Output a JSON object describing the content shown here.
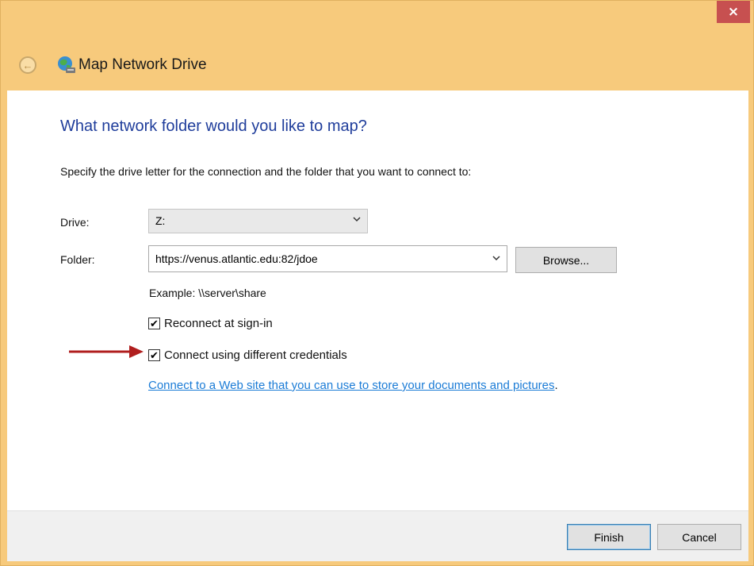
{
  "window": {
    "title": "Map Network Drive",
    "close_label": "×"
  },
  "back_icon": "back-arrow-icon",
  "app_icon": "network-drive-icon",
  "main": {
    "heading": "What network folder would you like to map?",
    "instruction": "Specify the drive letter for the connection and the folder that you want to connect to:",
    "drive": {
      "label": "Drive:",
      "value": "Z:"
    },
    "folder": {
      "label": "Folder:",
      "value": "https://venus.atlantic.edu:82/jdoe",
      "browse_label": "Browse..."
    },
    "example": "Example: \\\\server\\share",
    "reconnect": {
      "label": "Reconnect at sign-in",
      "checked": true
    },
    "different_credentials": {
      "label": "Connect using different credentials",
      "checked": true
    },
    "website_link": "Connect to a Web site that you can use to store your documents and pictures",
    "website_link_suffix": "."
  },
  "footer": {
    "finish_label": "Finish",
    "cancel_label": "Cancel"
  },
  "colors": {
    "titlebar": "#f7ca7c",
    "close_button": "#c75050",
    "heading": "#1f3d9b",
    "link": "#1a7bd6",
    "annotation_arrow": "#b01e1e"
  }
}
